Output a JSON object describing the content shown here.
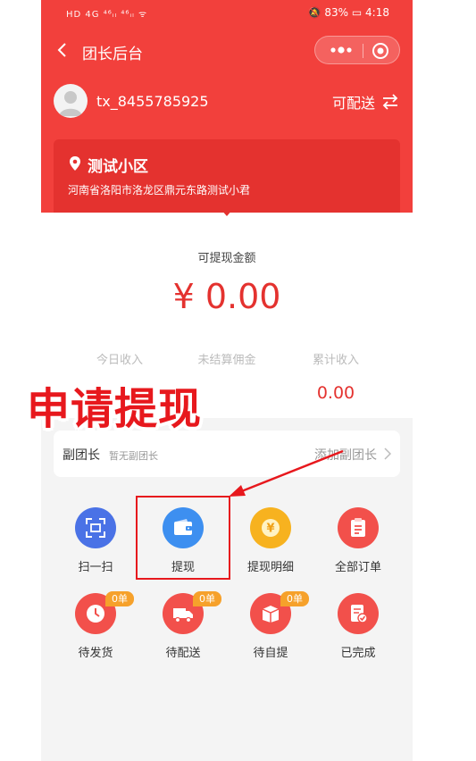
{
  "status_bar": {
    "left": "HD 4G ⁴⁶ᵢₗ ⁴⁶ᵢₗ ᯤ",
    "right": "🔕 83% ▭ 4:18"
  },
  "nav": {
    "title": "团长后台"
  },
  "user": {
    "name": "tx_8455785925",
    "mode_label": "可配送"
  },
  "community": {
    "name": "测试小区",
    "address": "河南省洛阳市洛龙区鼎元东路测试小君"
  },
  "balance": {
    "label": "可提现金额",
    "amount": "¥ 0.00",
    "stats": [
      {
        "label": "今日收入",
        "value": ""
      },
      {
        "label": "未结算佣金",
        "value": ""
      },
      {
        "label": "累计收入",
        "value": "0.00"
      }
    ]
  },
  "deputy": {
    "title": "副团长",
    "subtitle": "暂无副团长",
    "action": "添加副团长"
  },
  "actions": [
    {
      "label": "扫一扫",
      "icon": "scan-icon",
      "color": "#4a72e6"
    },
    {
      "label": "提现",
      "icon": "wallet-icon",
      "color": "#3d8ff0"
    },
    {
      "label": "提现明细",
      "icon": "yen-coin-icon",
      "color": "#f7b21f"
    },
    {
      "label": "全部订单",
      "icon": "clipboard-icon",
      "color": "#f2504b"
    }
  ],
  "orders": [
    {
      "label": "待发货",
      "badge": "0单",
      "icon": "clock-icon",
      "color": "#f2504b"
    },
    {
      "label": "待配送",
      "badge": "0单",
      "icon": "truck-icon",
      "color": "#f2504b"
    },
    {
      "label": "待自提",
      "badge": "0单",
      "icon": "box-icon",
      "color": "#f2504b"
    },
    {
      "label": "已完成",
      "badge": "",
      "icon": "done-document-icon",
      "color": "#f2504b"
    }
  ],
  "annotation": {
    "text": "申请提现"
  }
}
